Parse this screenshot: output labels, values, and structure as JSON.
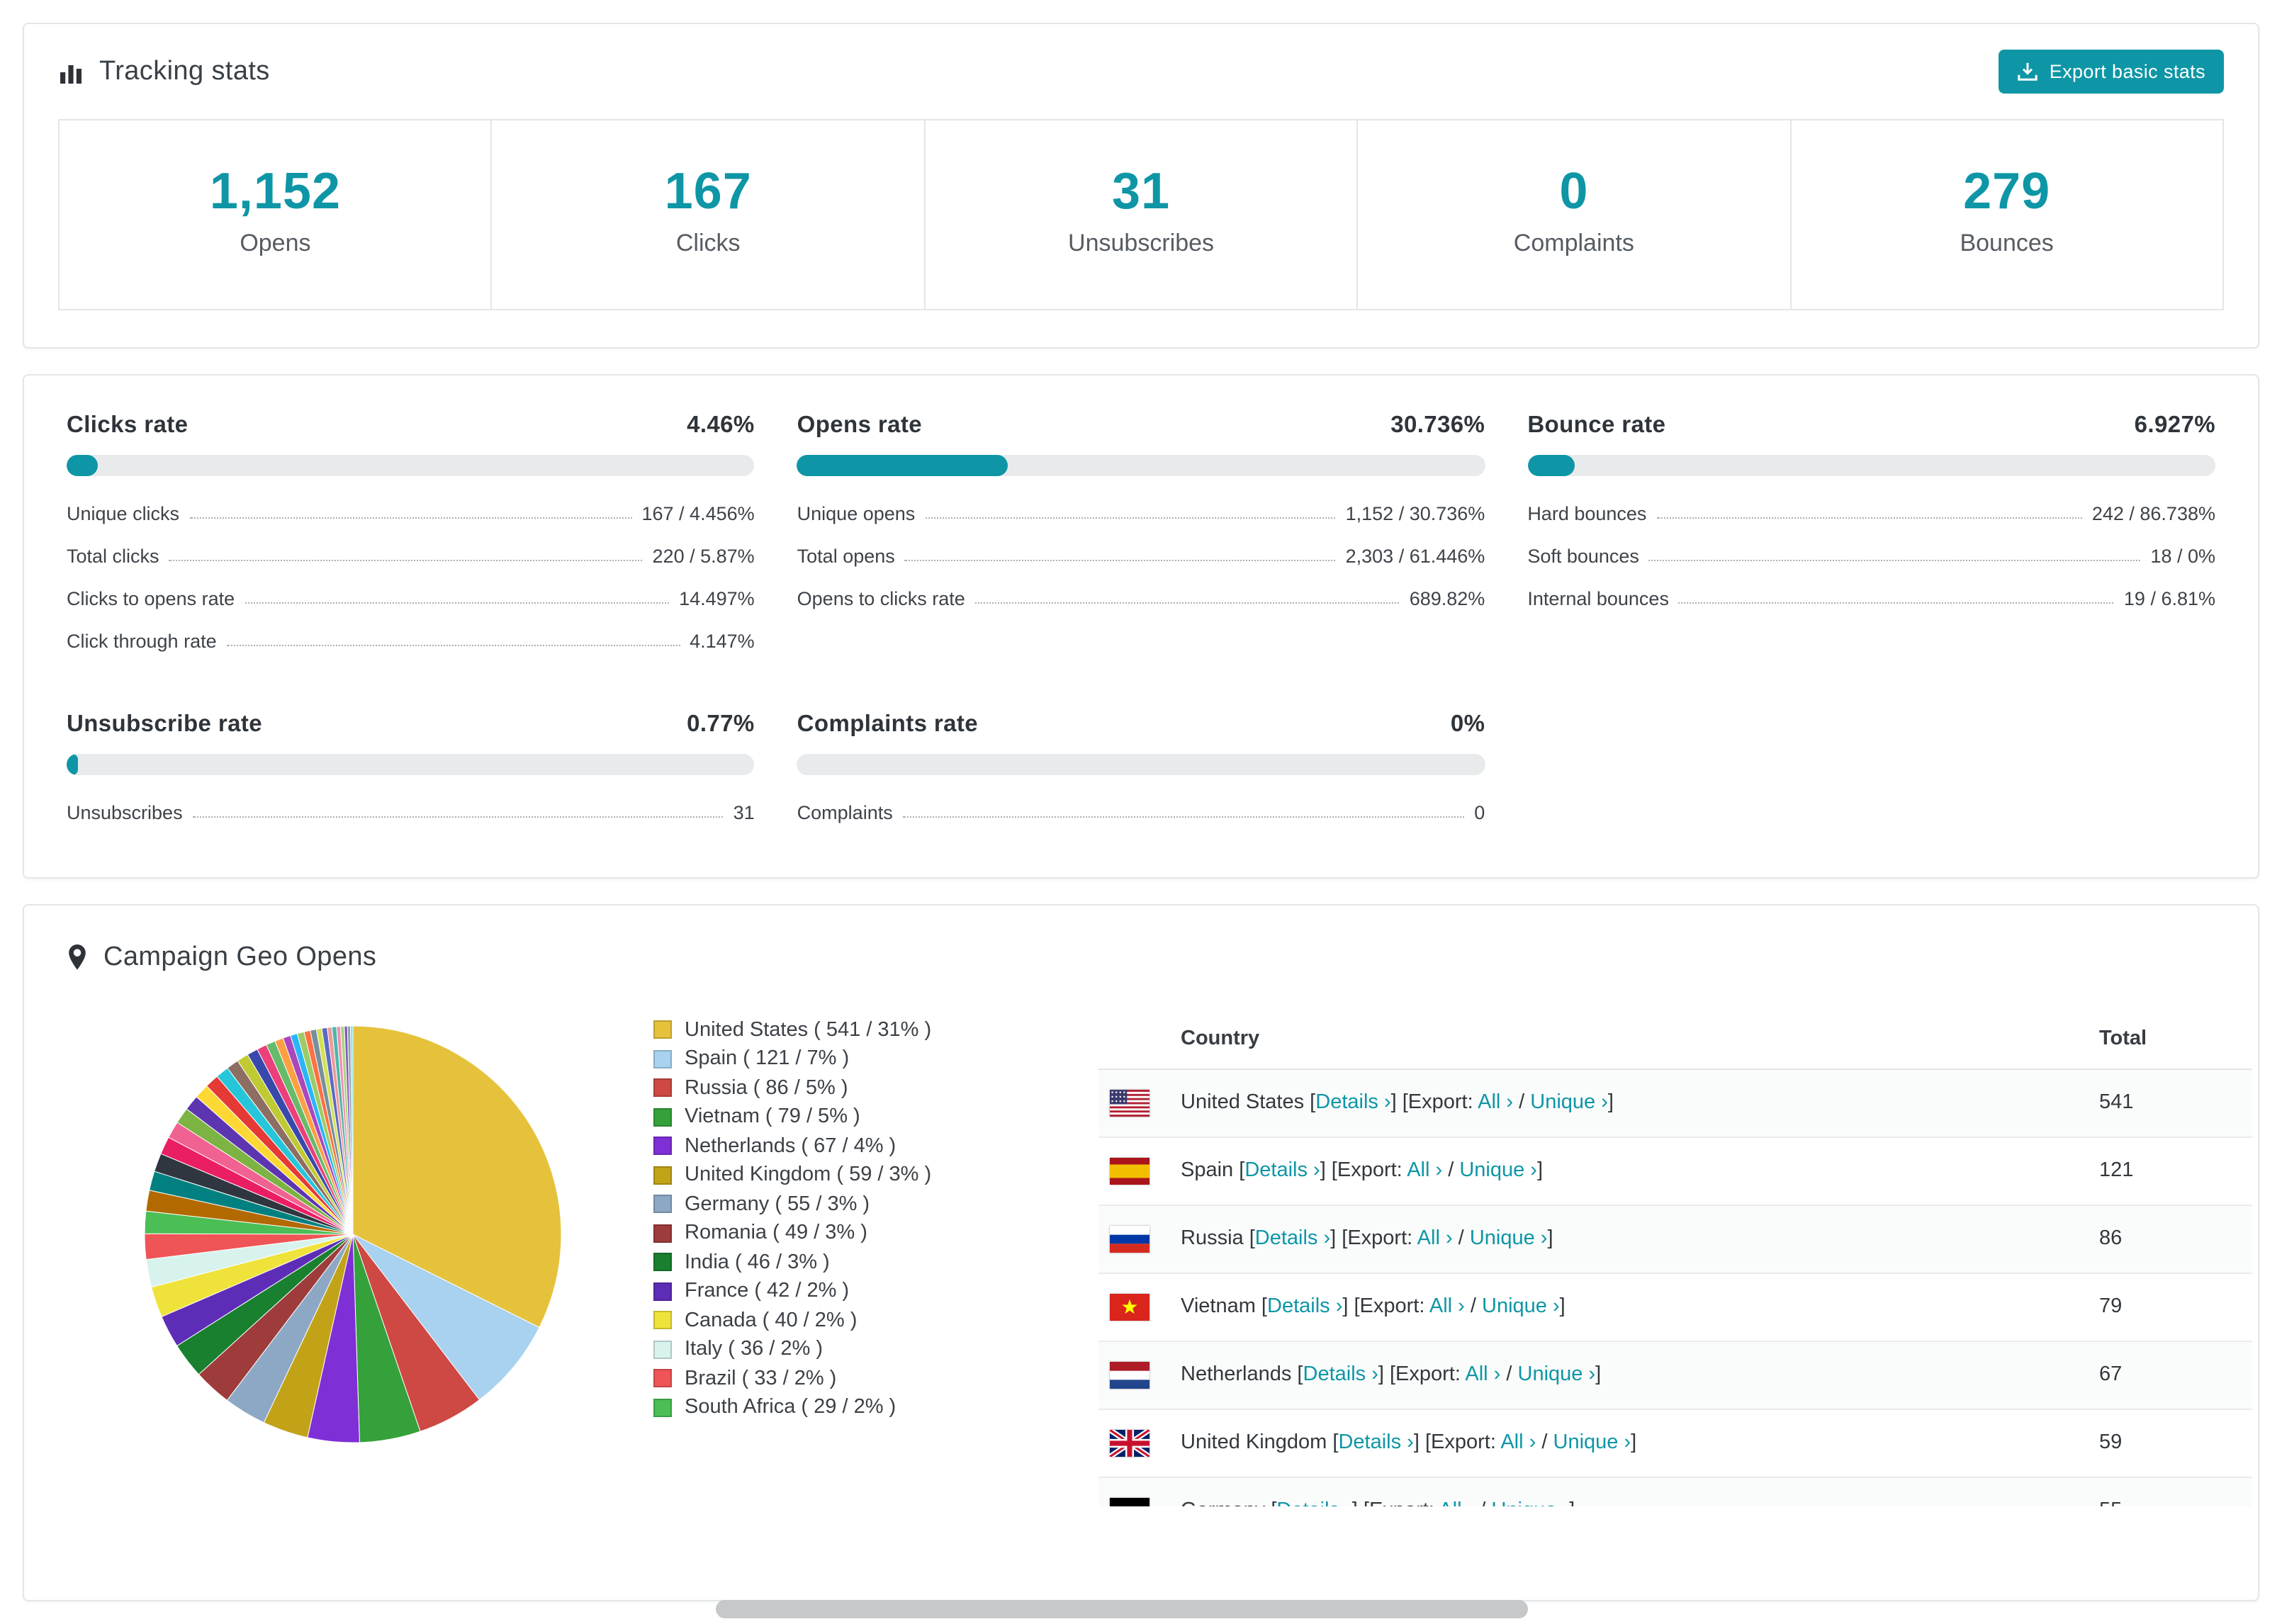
{
  "accent_color": "#0e96a6",
  "tracking": {
    "title": "Tracking stats",
    "export_button": "Export basic stats",
    "stats": [
      {
        "value": "1,152",
        "label": "Opens"
      },
      {
        "value": "167",
        "label": "Clicks"
      },
      {
        "value": "31",
        "label": "Unsubscribes"
      },
      {
        "value": "0",
        "label": "Complaints"
      },
      {
        "value": "279",
        "label": "Bounces"
      }
    ]
  },
  "rates": {
    "blocks": [
      {
        "title": "Clicks rate",
        "value": "4.46%",
        "percent": 4.46,
        "metrics": [
          {
            "label": "Unique clicks",
            "value": "167 / 4.456%"
          },
          {
            "label": "Total clicks",
            "value": "220 / 5.87%"
          },
          {
            "label": "Clicks to opens rate",
            "value": "14.497%"
          },
          {
            "label": "Click through rate",
            "value": "4.147%"
          }
        ]
      },
      {
        "title": "Opens rate",
        "value": "30.736%",
        "percent": 30.736,
        "metrics": [
          {
            "label": "Unique opens",
            "value": "1,152 / 30.736%"
          },
          {
            "label": "Total opens",
            "value": "2,303 / 61.446%"
          },
          {
            "label": "Opens to clicks rate",
            "value": "689.82%"
          }
        ]
      },
      {
        "title": "Bounce rate",
        "value": "6.927%",
        "percent": 6.927,
        "metrics": [
          {
            "label": "Hard bounces",
            "value": "242 / 86.738%"
          },
          {
            "label": "Soft bounces",
            "value": "18 / 0%"
          },
          {
            "label": "Internal bounces",
            "value": "19 / 6.81%"
          }
        ]
      },
      {
        "title": "Unsubscribe rate",
        "value": "0.77%",
        "percent": 0.77,
        "metrics": [
          {
            "label": "Unsubscribes",
            "value": "31"
          }
        ]
      },
      {
        "title": "Complaints rate",
        "value": "0%",
        "percent": 0,
        "metrics": [
          {
            "label": "Complaints",
            "value": "0"
          }
        ]
      }
    ]
  },
  "geo": {
    "title": "Campaign Geo Opens",
    "table": {
      "country_header": "Country",
      "total_header": "Total",
      "details_label": "Details",
      "export_label": "Export:",
      "all_label": "All",
      "unique_label": "Unique",
      "chevron": "›",
      "visible_rows": 7
    },
    "countries": [
      {
        "name": "United States",
        "flag": "us",
        "value": 541,
        "pct": 31
      },
      {
        "name": "Spain",
        "flag": "es",
        "value": 121,
        "pct": 7
      },
      {
        "name": "Russia",
        "flag": "ru",
        "value": 86,
        "pct": 5
      },
      {
        "name": "Vietnam",
        "flag": "vn",
        "value": 79,
        "pct": 5
      },
      {
        "name": "Netherlands",
        "flag": "nl",
        "value": 67,
        "pct": 4
      },
      {
        "name": "United Kingdom",
        "flag": "gb",
        "value": 59,
        "pct": 3
      },
      {
        "name": "Germany",
        "flag": "de",
        "value": 55,
        "pct": 3
      },
      {
        "name": "Romania",
        "flag": "ro",
        "value": 49,
        "pct": 3
      },
      {
        "name": "India",
        "flag": "in",
        "value": 46,
        "pct": 3
      },
      {
        "name": "France",
        "flag": "fr",
        "value": 42,
        "pct": 2
      },
      {
        "name": "Canada",
        "flag": "ca",
        "value": 40,
        "pct": 2
      },
      {
        "name": "Italy",
        "flag": "it",
        "value": 36,
        "pct": 2
      },
      {
        "name": "Brazil",
        "flag": "br",
        "value": 33,
        "pct": 2
      },
      {
        "name": "South Africa",
        "flag": "za",
        "value": 29,
        "pct": 2
      }
    ]
  },
  "chart_data": {
    "type": "pie",
    "title": "Campaign Geo Opens",
    "legend_position": "right",
    "labels": [
      "United States",
      "Spain",
      "Russia",
      "Vietnam",
      "Netherlands",
      "United Kingdom",
      "Germany",
      "Romania",
      "India",
      "France",
      "Canada",
      "Italy",
      "Brazil",
      "South Africa"
    ],
    "values": [
      541,
      121,
      86,
      79,
      67,
      59,
      55,
      49,
      46,
      42,
      40,
      36,
      33,
      29
    ],
    "percents": [
      31,
      7,
      5,
      5,
      4,
      3,
      3,
      3,
      3,
      2,
      2,
      2,
      2,
      2
    ],
    "colors": [
      "#e6c23c",
      "#a8d2f0",
      "#ce4844",
      "#35a13b",
      "#7f2fd6",
      "#c2a318",
      "#8ca8c4",
      "#9e3b3b",
      "#19802f",
      "#5e2db8",
      "#efe23b",
      "#d8f3ee",
      "#ef5456",
      "#4bbe55"
    ],
    "other_slices": {
      "description": "many small unlabeled slices shown in the pie",
      "values": [
        27,
        25,
        24,
        23,
        22,
        21,
        20,
        19,
        18,
        17,
        16,
        15,
        14,
        13,
        12,
        11,
        10,
        9,
        9,
        8,
        8,
        7,
        7,
        6,
        6,
        5,
        5,
        4,
        4,
        3
      ],
      "colors": [
        "#b26a00",
        "#008080",
        "#2f3640",
        "#e91e63",
        "#f06292",
        "#7cb342",
        "#5e35b1",
        "#fdd835",
        "#e53935",
        "#26c6da",
        "#8d6e63",
        "#c0ca33",
        "#3949ab",
        "#ec407a",
        "#66bb6a",
        "#ff9f43",
        "#ab47bc",
        "#29b6f6",
        "#9ccc65",
        "#ff7043",
        "#78909c",
        "#d4e157",
        "#5c6bc0",
        "#ef9a9a",
        "#4db6ac",
        "#f48fb1",
        "#aed581",
        "#7e57c2",
        "#90a4ae",
        "#80deea"
      ]
    }
  }
}
